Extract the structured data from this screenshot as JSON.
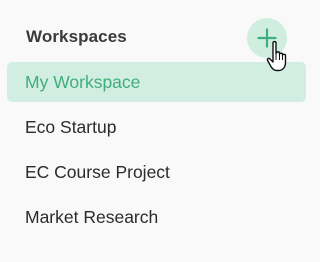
{
  "header": {
    "title": "Workspaces",
    "add_icon": "plus-icon"
  },
  "workspaces": [
    {
      "label": "My Workspace",
      "active": true
    },
    {
      "label": "Eco Startup",
      "active": false
    },
    {
      "label": "EC Course Project",
      "active": false
    },
    {
      "label": "Market Research",
      "active": false
    }
  ],
  "colors": {
    "accent": "#3fae7c",
    "active_bg": "#d2eee2",
    "button_bg": "#cfeee0"
  },
  "cursor_icon": "hand-pointer-icon"
}
